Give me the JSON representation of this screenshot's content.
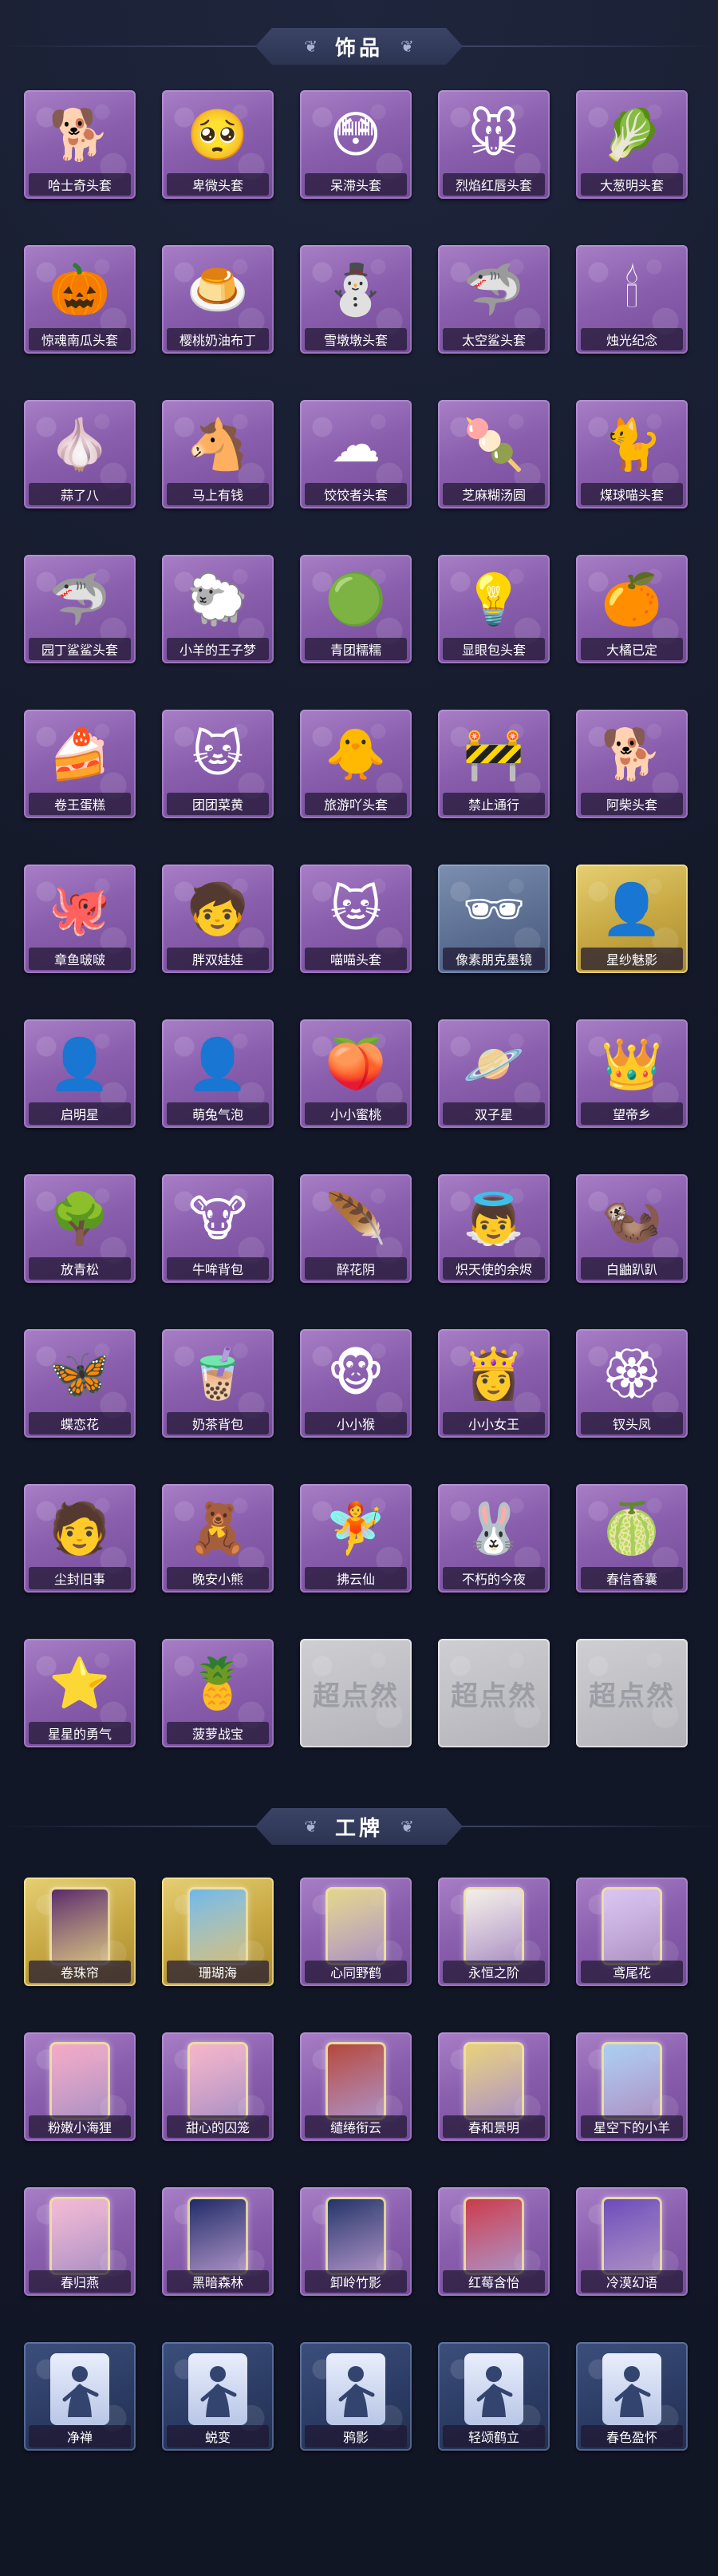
{
  "sections": {
    "accessories": {
      "title": "饰品"
    },
    "badges": {
      "title": "工牌"
    }
  },
  "accessories": [
    {
      "label": "哈士奇头套",
      "icon": "dog-head-icon",
      "glyph": "🐕"
    },
    {
      "label": "卑微头套",
      "icon": "sad-face-head-icon",
      "glyph": "🥺"
    },
    {
      "label": "呆滞头套",
      "icon": "dull-face-head-icon",
      "glyph": "😳"
    },
    {
      "label": "烈焰红唇头套",
      "icon": "pikachu-lips-head-icon",
      "glyph": "🐭"
    },
    {
      "label": "大葱明头套",
      "icon": "scallion-head-icon",
      "glyph": "🥬"
    },
    {
      "label": "惊魂南瓜头套",
      "icon": "pumpkin-head-icon",
      "glyph": "🎃"
    },
    {
      "label": "樱桃奶油布丁",
      "icon": "pudding-head-icon",
      "glyph": "🍮"
    },
    {
      "label": "雪墩墩头套",
      "icon": "snowman-head-icon",
      "glyph": "⛄"
    },
    {
      "label": "太空鲨头套",
      "icon": "space-shark-head-icon",
      "glyph": "🦈"
    },
    {
      "label": "烛光纪念",
      "icon": "candle-head-icon",
      "glyph": "🕯"
    },
    {
      "label": "蒜了八",
      "icon": "garlic-head-icon",
      "glyph": "🧄"
    },
    {
      "label": "马上有钱",
      "icon": "horse-head-icon",
      "glyph": "🐴"
    },
    {
      "label": "饺饺者头套",
      "icon": "cloud-head-icon",
      "glyph": "☁"
    },
    {
      "label": "芝麻糊汤圆",
      "icon": "tangyuan-head-icon",
      "glyph": "🍡"
    },
    {
      "label": "煤球喵头套",
      "icon": "black-cat-head-icon",
      "glyph": "🐈"
    },
    {
      "label": "园丁鲨鲨头套",
      "icon": "gardener-shark-head-icon",
      "glyph": "🦈"
    },
    {
      "label": "小羊的王子梦",
      "icon": "lamb-prince-head-icon",
      "glyph": "🐑"
    },
    {
      "label": "青团糯糯",
      "icon": "qingtuan-head-icon",
      "glyph": "🟢"
    },
    {
      "label": "显眼包头套",
      "icon": "lightbulb-head-icon",
      "glyph": "💡"
    },
    {
      "label": "大橘已定",
      "icon": "orange-head-icon",
      "glyph": "🍊"
    },
    {
      "label": "卷王蛋糕",
      "icon": "swiss-roll-head-icon",
      "glyph": "🍰"
    },
    {
      "label": "团团菜黄",
      "icon": "cat-bun-head-icon",
      "glyph": "🐱"
    },
    {
      "label": "旅游吖头套",
      "icon": "duck-hat-head-icon",
      "glyph": "🐥"
    },
    {
      "label": "禁止通行",
      "icon": "traffic-cone-head-icon",
      "glyph": "🚧"
    },
    {
      "label": "阿柴头套",
      "icon": "shiba-head-icon",
      "glyph": "🐕"
    },
    {
      "label": "章鱼啵啵",
      "icon": "octopus-head-icon",
      "glyph": "🐙"
    },
    {
      "label": "胖双娃娃",
      "icon": "doll-head-icon",
      "glyph": "🧒"
    },
    {
      "label": "喵喵头套",
      "icon": "cat-head-icon",
      "glyph": "🐱"
    },
    {
      "label": "像素朋克墨镜",
      "icon": "pixel-sunglasses-icon",
      "glyph": "🕶",
      "variant": "blue"
    },
    {
      "label": "星纱魅影",
      "icon": "veil-icon",
      "glyph": "👤",
      "variant": "gold"
    },
    {
      "label": "启明星",
      "icon": "morning-star-icon",
      "glyph": "👤"
    },
    {
      "label": "萌兔气泡",
      "icon": "bunny-bubble-icon",
      "glyph": "👤"
    },
    {
      "label": "小小蜜桃",
      "icon": "peach-icon",
      "glyph": "🍑"
    },
    {
      "label": "双子星",
      "icon": "twin-stars-icon",
      "glyph": "🪐"
    },
    {
      "label": "望帝乡",
      "icon": "opera-crown-icon",
      "glyph": "👑"
    },
    {
      "label": "放青松",
      "icon": "bonsai-icon",
      "glyph": "🌳"
    },
    {
      "label": "牛哞背包",
      "icon": "cow-backpack-icon",
      "glyph": "🐮"
    },
    {
      "label": "醉花阴",
      "icon": "dreamcatcher-icon",
      "glyph": "🪶"
    },
    {
      "label": "炽天使的余烬",
      "icon": "seraph-icon",
      "glyph": "👼"
    },
    {
      "label": "白鼬趴趴",
      "icon": "ferret-icon",
      "glyph": "🦦"
    },
    {
      "label": "蝶恋花",
      "icon": "butterfly-ornament-icon",
      "glyph": "🦋"
    },
    {
      "label": "奶茶背包",
      "icon": "milk-tea-bag-icon",
      "glyph": "🧋"
    },
    {
      "label": "小小猴",
      "icon": "monkey-icon",
      "glyph": "🐵"
    },
    {
      "label": "小小女王",
      "icon": "queen-icon",
      "glyph": "👸"
    },
    {
      "label": "钗头凤",
      "icon": "hairpin-icon",
      "glyph": "🏵"
    },
    {
      "label": "尘封旧事",
      "icon": "chibi-keychain-icon",
      "glyph": "🧑"
    },
    {
      "label": "晚安小熊",
      "icon": "bear-keychain-icon",
      "glyph": "🧸"
    },
    {
      "label": "拂云仙",
      "icon": "fairy-pendant-icon",
      "glyph": "🧚"
    },
    {
      "label": "不朽的今夜",
      "icon": "bunny-pendant-icon",
      "glyph": "🐰"
    },
    {
      "label": "春信香囊",
      "icon": "sachet-icon",
      "glyph": "🍈"
    },
    {
      "label": "星星的勇气",
      "icon": "star-keychain-icon",
      "glyph": "⭐"
    },
    {
      "label": "菠萝战宝",
      "icon": "pineapple-keychain-icon",
      "glyph": "🍍"
    },
    {
      "label": "",
      "icon": "locked-watermark-icon",
      "variant": "silver",
      "watermark": "超点然"
    },
    {
      "label": "",
      "icon": "locked-watermark-icon",
      "variant": "silver",
      "watermark": "超点然"
    },
    {
      "label": "",
      "icon": "locked-watermark-icon",
      "variant": "silver",
      "watermark": "超点然"
    }
  ],
  "badges": [
    {
      "label": "卷珠帘",
      "icon": "curtain-badge-icon",
      "variant": "gold",
      "frame": "#5a2a6a"
    },
    {
      "label": "珊瑚海",
      "icon": "coral-badge-icon",
      "variant": "gold",
      "frame": "#6fb6e8"
    },
    {
      "label": "心同野鹤",
      "icon": "crane-badge-icon",
      "frame": "#e2d58a"
    },
    {
      "label": "永恒之阶",
      "icon": "angel-badge-icon",
      "frame": "#f2efe6"
    },
    {
      "label": "鸢尾花",
      "icon": "iris-badge-icon",
      "frame": "#d9c4f0"
    },
    {
      "label": "粉嫩小海狸",
      "icon": "beaver-badge-icon",
      "frame": "#f3a9c4"
    },
    {
      "label": "甜心的囚笼",
      "icon": "heart-cage-badge-icon",
      "frame": "#f5b4c8"
    },
    {
      "label": "缱绻衔云",
      "icon": "cloud-badge-icon",
      "frame": "#b4463a"
    },
    {
      "label": "春和景明",
      "icon": "spring-badge-icon",
      "frame": "#e6d07a"
    },
    {
      "label": "星空下的小羊",
      "icon": "lamb-star-badge-icon",
      "frame": "#a9cdf0"
    },
    {
      "label": "春归燕",
      "icon": "swallow-badge-icon",
      "frame": "#f3b9d2"
    },
    {
      "label": "黑暗森林",
      "icon": "forest-badge-icon",
      "frame": "#1e2a66"
    },
    {
      "label": "卸岭竹影",
      "icon": "bamboo-badge-icon",
      "frame": "#223366"
    },
    {
      "label": "红莓含怡",
      "icon": "berry-badge-icon",
      "frame": "#c93a4a"
    },
    {
      "label": "冷漠幻语",
      "icon": "galaxy-badge-icon",
      "frame": "#6a4ab8"
    },
    {
      "label": "净禅",
      "icon": "pose-badge-icon",
      "variant": "navy"
    },
    {
      "label": "蜕变",
      "icon": "pose-badge-icon",
      "variant": "navy"
    },
    {
      "label": "鸦影",
      "icon": "pose-badge-icon",
      "variant": "navy"
    },
    {
      "label": "轻颂鹤立",
      "icon": "pose-badge-icon",
      "variant": "navy"
    },
    {
      "label": "春色盈怀",
      "icon": "pose-badge-icon",
      "variant": "navy"
    }
  ]
}
